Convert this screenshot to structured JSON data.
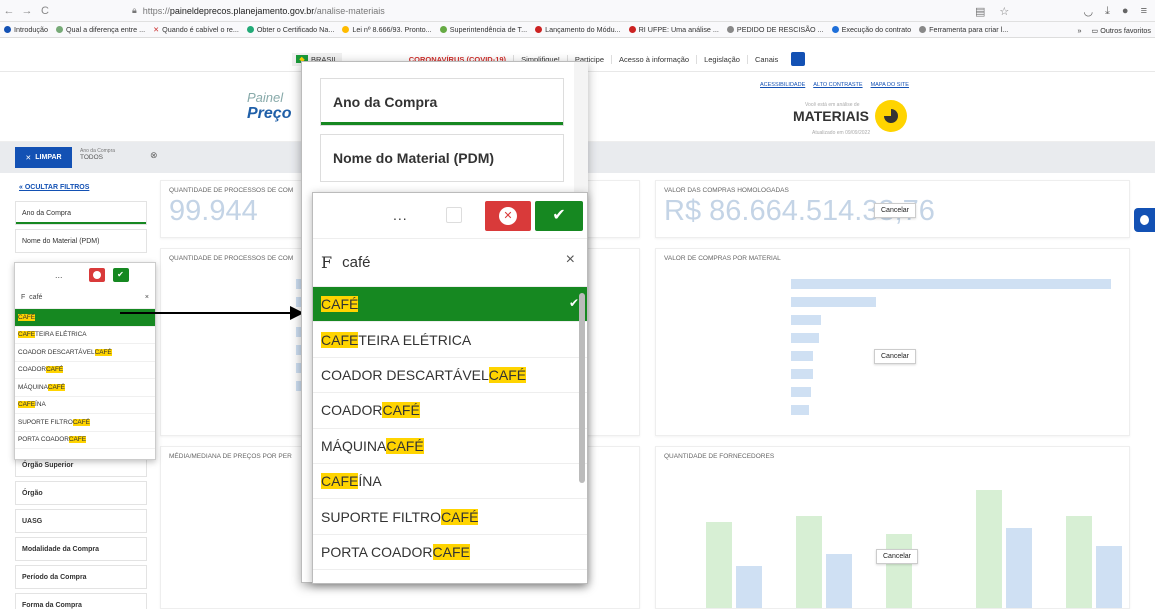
{
  "browser": {
    "nav": [
      "←",
      "→",
      "C"
    ],
    "url_prefix": "https://",
    "url_domain": "paineldeprecos.planejamento.gov.br",
    "url_path": "/analise-materiais",
    "bookmarks": [
      "Introdução",
      "Qual a diferença entre ...",
      "Quando é cabível o re...",
      "Obter o Certificado Na...",
      "Lei nº 8.666/93. Pronto...",
      "Superintendência de T...",
      "Lançamento do Módu...",
      "RI UFPE: Uma análise ...",
      "PEDIDO DE RESCISÃO ...",
      "Execução do contrato",
      "Ferramenta para criar l..."
    ],
    "bookmarks_more": "»",
    "other_favorites": "Outros favoritos"
  },
  "gov_bar": {
    "country": "BRASIL",
    "links": [
      "CORONAVÍRUS (COVID-19)",
      "Simplifique!",
      "Participe",
      "Acesso à informação",
      "Legislação",
      "Canais"
    ]
  },
  "header": {
    "logo_line1": "Painel",
    "logo_line2": "Preço",
    "top_links": [
      "ACESSIBILIDADE",
      "ALTO CONTRASTE",
      "MAPA DO SITE"
    ],
    "subtitle": "Você está em análise de",
    "title": "MATERIAIS",
    "updated": "Atualizado em 09/09/2022"
  },
  "filterbar": {
    "clear_label": "LIMPAR",
    "chip_caption": "Ano da Compra",
    "chip_value": "TODOS"
  },
  "sidebar": {
    "hide_label": "« OCULTAR FILTROS",
    "items_top": [
      "Ano da Compra",
      "Nome do Material (PDM)"
    ],
    "items_bottom": [
      "Órgão Superior",
      "Órgão",
      "UASG",
      "Modalidade da Compra",
      "Período da Compra",
      "Forma da Compra"
    ]
  },
  "small_dropdown": {
    "dots": "...",
    "search_prefix": "F",
    "search_value": "café",
    "clear": "×",
    "rows": [
      {
        "hl": "CAFÉ",
        "rest": "",
        "pre": ""
      },
      {
        "hl": "CAFE",
        "rest": "TEIRA ELÉTRICA",
        "pre": ""
      },
      {
        "pre": "COADOR DESCARTÁVEL ",
        "hl": "CAFÉ",
        "rest": ""
      },
      {
        "pre": "COADOR ",
        "hl": "CAFÉ",
        "rest": ""
      },
      {
        "pre": "MÁQUINA ",
        "hl": "CAFÉ",
        "rest": ""
      },
      {
        "pre": "",
        "hl": "CAFE",
        "rest": "ÍNA"
      },
      {
        "pre": "SUPORTE FILTRO ",
        "hl": "CAFÉ",
        "rest": ""
      },
      {
        "pre": "PORTA COADOR ",
        "hl": "CAFE",
        "rest": ""
      }
    ]
  },
  "panels": {
    "qtd_processos_title": "QUANTIDADE DE PROCESSOS DE COM",
    "qtd_processos_value": "99.944",
    "valor_homologadas_title": "VALOR DAS COMPRAS HOMOLOGADAS",
    "valor_homologadas_value": "R$ 86.664.514.3",
    "valor_homologadas_tail": "3,76",
    "qtd_material_title": "QUANTIDADE DE PROCESSOS DE COM",
    "valor_material_title": "VALOR DE COMPRAS POR MATERIAL",
    "media_title": "MÉDIA/MEDIANA DE PREÇOS POR PER",
    "fornecedores_title": "QUANTIDADE DE FORNECEDORES",
    "cancel_label": "Cancelar"
  },
  "big_popup": {
    "field1": "Ano da Compra",
    "field2": "Nome do Material (PDM)",
    "dots": "...",
    "ok": "✔",
    "search_prefix": "F",
    "search_value": "café",
    "clear": "×",
    "rows": [
      {
        "pre": "",
        "hl": "CAFÉ",
        "rest": ""
      },
      {
        "pre": "",
        "hl": "CAFE",
        "rest": "TEIRA ELÉTRICA"
      },
      {
        "pre": "COADOR DESCARTÁVEL ",
        "hl": "CAFÉ",
        "rest": ""
      },
      {
        "pre": "COADOR ",
        "hl": "CAFÉ",
        "rest": ""
      },
      {
        "pre": "MÁQUINA ",
        "hl": "CAFÉ",
        "rest": ""
      },
      {
        "pre": "",
        "hl": "CAFE",
        "rest": "ÍNA"
      },
      {
        "pre": "SUPORTE FILTRO ",
        "hl": "CAFÉ",
        "rest": ""
      },
      {
        "pre": "PORTA COADOR ",
        "hl": "CAFE",
        "rest": ""
      }
    ]
  }
}
